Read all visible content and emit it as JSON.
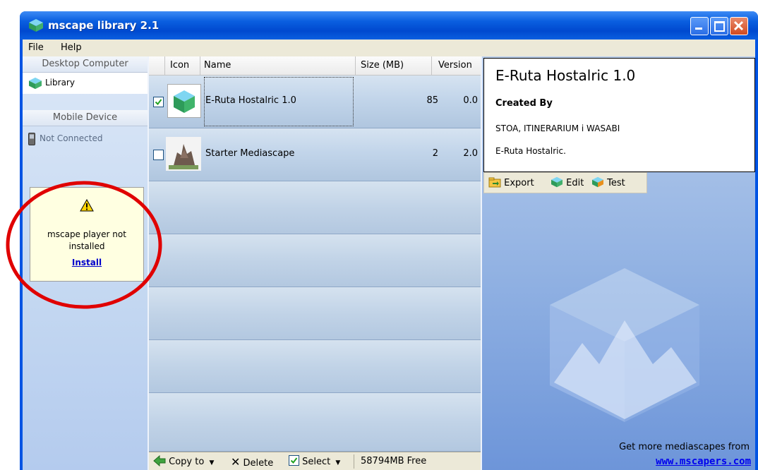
{
  "window": {
    "title": "mscape library 2.1"
  },
  "menu": {
    "items": [
      "File",
      "Help"
    ]
  },
  "left_panel": {
    "desktop_header": "Desktop Computer",
    "library_label": "Library",
    "mobile_header": "Mobile Device",
    "not_connected_label": "Not Connected",
    "warning": {
      "message_line1": "mscape player not",
      "message_line2": "installed",
      "install_link": "Install"
    }
  },
  "list": {
    "columns": {
      "icon": "Icon",
      "name": "Name",
      "size": "Size (MB)",
      "version": "Version"
    },
    "rows": [
      {
        "checked": true,
        "name": "E-Ruta Hostalric 1.0",
        "size": "85",
        "version": "0.0"
      },
      {
        "checked": false,
        "name": "Starter Mediascape",
        "size": "2",
        "version": "2.0"
      }
    ]
  },
  "bottom_bar": {
    "copy_to": "Copy to",
    "delete": "Delete",
    "select": "Select",
    "free_space": "58794MB Free"
  },
  "details": {
    "title": "E-Ruta Hostalric 1.0",
    "created_by_label": "Created By",
    "authors": "STOA, ITINERARIUM i WASABI",
    "description": "E-Ruta Hostalric."
  },
  "detail_toolbar": {
    "export": "Export",
    "edit": "Edit",
    "test": "Test"
  },
  "footer": {
    "text": "Get more mediascapes from",
    "link": "www.mscapers.com"
  }
}
